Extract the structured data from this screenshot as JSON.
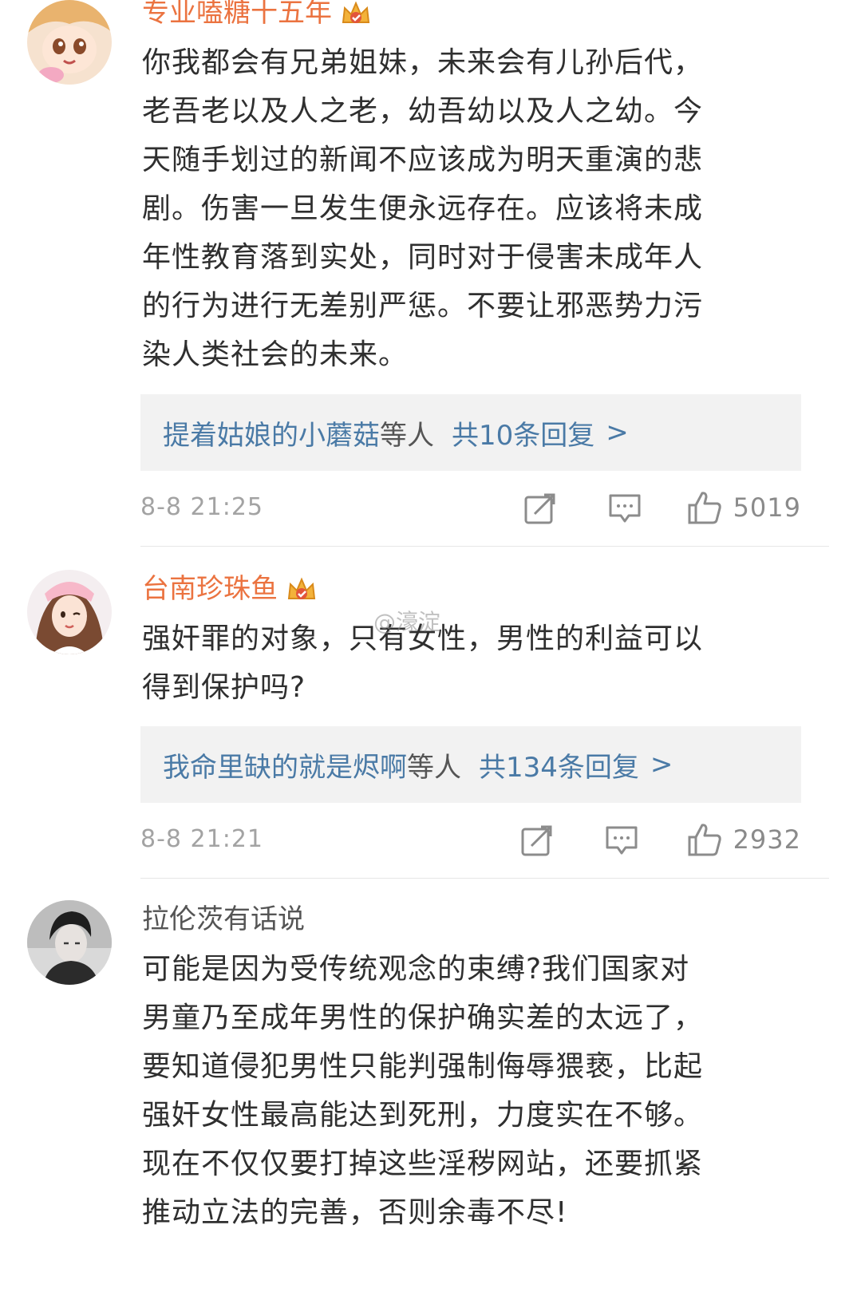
{
  "watermark": "@濠淀",
  "comments": [
    {
      "username": "专业嗑糖十五年",
      "vip": true,
      "text": "你我都会有兄弟姐妹，未来会有儿孙后代，\n老吾老以及人之老，幼吾幼以及人之幼。今\n天随手划过的新闻不应该成为明天重演的悲\n剧。伤害一旦发生便永远存在。应该将未成\n年性教育落到实处，同时对于侵害未成年人\n的行为进行无差别严惩。不要让邪恶势力污\n染人类社会的未来。",
      "reply_names": "提着姑娘的小蘑菇",
      "reply_suffix": "等人",
      "reply_count": "共10条回复",
      "reply_arrow": ">",
      "timestamp": "8-8 21:25",
      "likes": "5019"
    },
    {
      "username": "台南珍珠鱼",
      "vip": true,
      "text": "强奸罪的对象，只有女性，男性的利益可以\n得到保护吗?",
      "reply_names": "我命里缺的就是烬啊",
      "reply_suffix": "等人",
      "reply_count": "共134条回复",
      "reply_arrow": ">",
      "timestamp": "8-8 21:21",
      "likes": "2932"
    },
    {
      "username": "拉伦茨有话说",
      "vip": false,
      "text": "可能是因为受传统观念的束缚?我们国家对\n男童乃至成年男性的保护确实差的太远了，\n要知道侵犯男性只能判强制侮辱猥亵，比起\n强奸女性最高能达到死刑，力度实在不够。\n现在不仅仅要打掉这些淫秽网站，还要抓紧\n推动立法的完善，否则余毒不尽!"
    }
  ],
  "icons": {
    "repost": "repost-icon",
    "comment": "comment-icon",
    "like": "thumbs-up-icon",
    "crown": "vip-crown-icon"
  },
  "colors": {
    "username_vip": "#eb7340",
    "username_plain": "#555555",
    "link": "#4a7aa6",
    "timestamp": "#a3a3a3",
    "reply_bg": "#f2f2f2"
  }
}
